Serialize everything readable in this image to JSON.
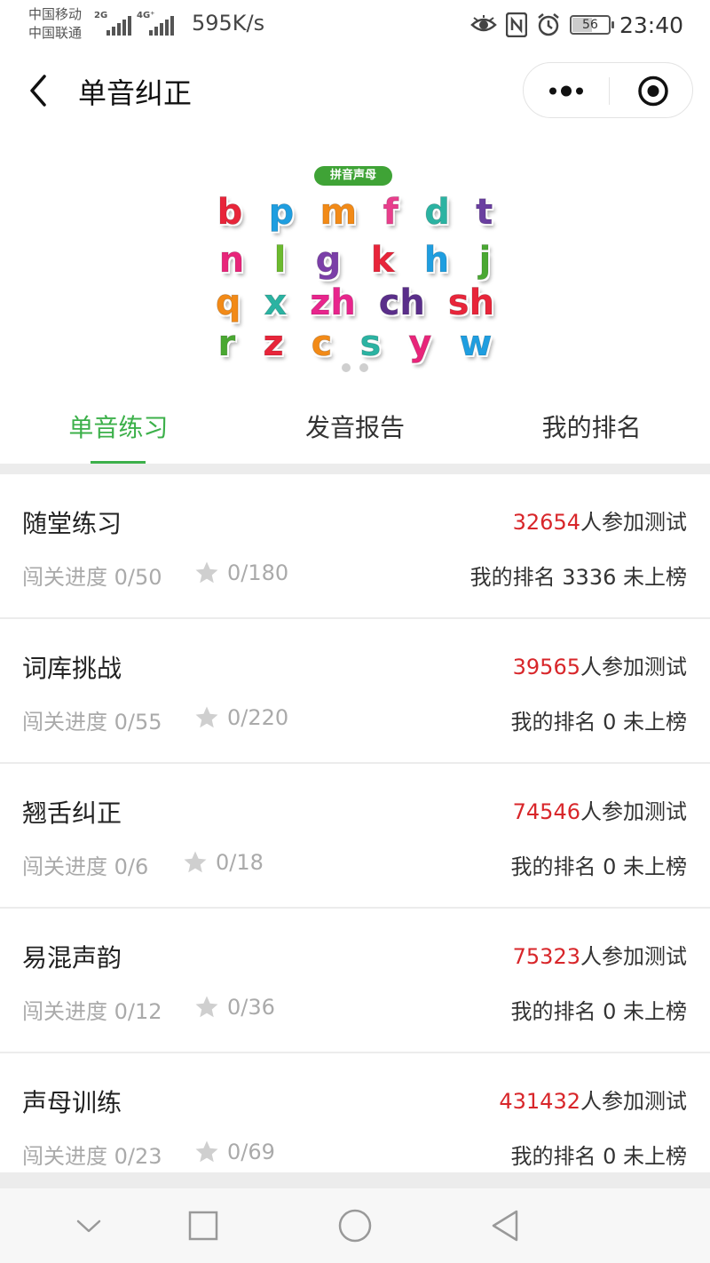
{
  "status_bar": {
    "carrier_1": "中国移动",
    "carrier_2": "中国联通",
    "sim1_tag": "2G",
    "sim2_tag": "4G⁺",
    "net_speed": "595K/s",
    "icons": [
      "eye-icon",
      "nfc-icon",
      "alarm-icon"
    ],
    "battery_level": 56,
    "battery_label": "56",
    "time": "23:40"
  },
  "nav": {
    "title": "单音纠正",
    "back_icon": "chevron-left-icon",
    "more_icon": "more-dots-icon",
    "close_icon": "target-close-icon"
  },
  "banner": {
    "tag": "拼音声母",
    "rows": [
      [
        "b",
        "p",
        "m",
        "f",
        "d",
        "t"
      ],
      [
        "n",
        "l",
        "g",
        "k",
        "h",
        "j"
      ],
      [
        "q",
        "x",
        "zh",
        "ch",
        "sh"
      ],
      [
        "r",
        "z",
        "c",
        "s",
        "y",
        "w"
      ]
    ],
    "colors": [
      [
        "#e8253a",
        "#1f9ee0",
        "#f28a17",
        "#e83e8c",
        "#2bb3a2",
        "#6a3fa0"
      ],
      [
        "#e8257a",
        "#6cba2e",
        "#7b3fa8",
        "#e8253a",
        "#1f9ee0",
        "#4aa832"
      ],
      [
        "#f28a17",
        "#2bb3a2",
        "#e8258c",
        "#5a2e8a",
        "#e8253a"
      ],
      [
        "#4aa832",
        "#e8253a",
        "#f28a17",
        "#2bb3a2",
        "#e8257a",
        "#1f9ee0"
      ]
    ],
    "carousel_pages": 2
  },
  "tabs": [
    {
      "label": "单音练习",
      "active": true
    },
    {
      "label": "发音报告",
      "active": false
    },
    {
      "label": "我的排名",
      "active": false
    }
  ],
  "items": [
    {
      "title": "随堂练习",
      "count": "32654",
      "count_suffix": "人参加测试",
      "progress": "闯关进度 0/50",
      "stars": "0/180",
      "rank": "我的排名 3336 未上榜"
    },
    {
      "title": "词库挑战",
      "count": "39565",
      "count_suffix": "人参加测试",
      "progress": "闯关进度 0/55",
      "stars": "0/220",
      "rank": "我的排名 0 未上榜"
    },
    {
      "title": "翘舌纠正",
      "count": "74546",
      "count_suffix": "人参加测试",
      "progress": "闯关进度 0/6",
      "stars": "0/18",
      "rank": "我的排名 0 未上榜"
    },
    {
      "title": "易混声韵",
      "count": "75323",
      "count_suffix": "人参加测试",
      "progress": "闯关进度 0/12",
      "stars": "0/36",
      "rank": "我的排名 0 未上榜"
    },
    {
      "title": "声母训练",
      "count": "431432",
      "count_suffix": "人参加测试",
      "progress": "闯关进度 0/23",
      "stars": "0/69",
      "rank": "我的排名 0 未上榜"
    }
  ],
  "system_nav": [
    "chevron-down-icon",
    "square-icon",
    "circle-icon",
    "triangle-back-icon"
  ],
  "theme": {
    "accent": "#3cb04a",
    "count_red": "#d8262a",
    "muted": "#aaaaaa"
  }
}
